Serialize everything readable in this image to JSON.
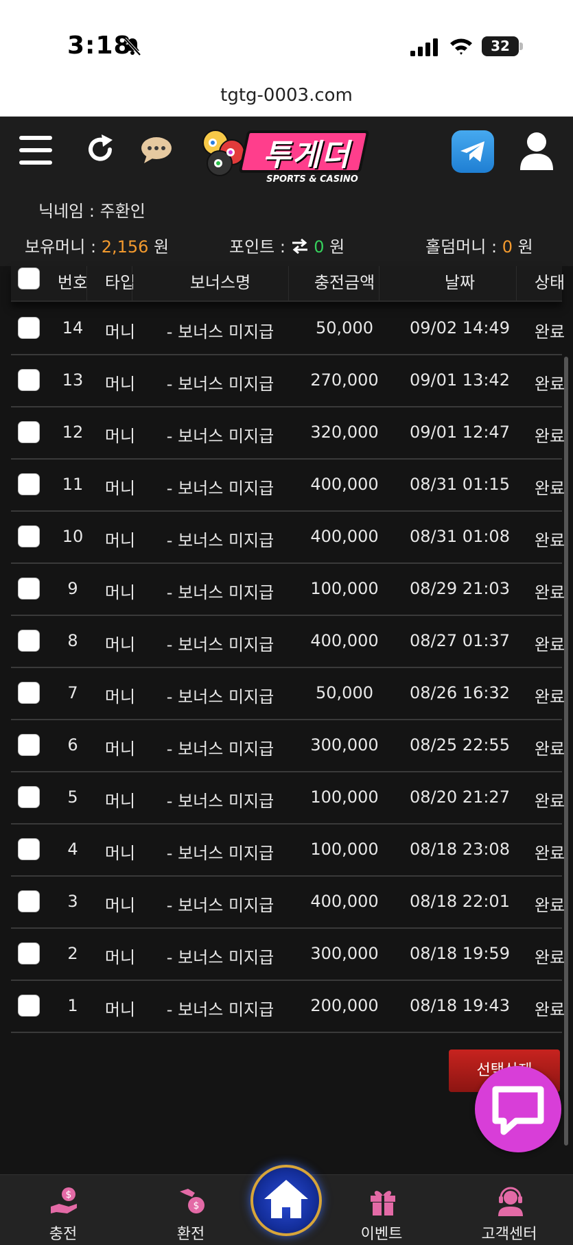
{
  "status_bar": {
    "time": "3:18",
    "battery": "32"
  },
  "browser": {
    "url": "tgtg-0003.com"
  },
  "header": {
    "logo_name": "투게더",
    "logo_sub": "SPORTS & CASINO",
    "nickname_label": "닉네임 : 주환인",
    "money_label": "보유머니 :",
    "money_value": "2,156",
    "money_unit": "원",
    "point_label": "포인트 :",
    "point_value": "0",
    "point_unit": "원",
    "holdem_label": "홀덤머니 :",
    "holdem_value": "0",
    "holdem_unit": "원"
  },
  "table": {
    "headers": [
      "번호",
      "타입",
      "보너스명",
      "충전금액",
      "날짜",
      "상태"
    ],
    "rows": [
      {
        "no": "14",
        "type": "머니",
        "bonus": "- 보너스 미지급",
        "amount": "50,000",
        "date": "09/02 14:49",
        "status": "완료"
      },
      {
        "no": "13",
        "type": "머니",
        "bonus": "- 보너스 미지급",
        "amount": "270,000",
        "date": "09/01 13:42",
        "status": "완료"
      },
      {
        "no": "12",
        "type": "머니",
        "bonus": "- 보너스 미지급",
        "amount": "320,000",
        "date": "09/01 12:47",
        "status": "완료"
      },
      {
        "no": "11",
        "type": "머니",
        "bonus": "- 보너스 미지급",
        "amount": "400,000",
        "date": "08/31 01:15",
        "status": "완료"
      },
      {
        "no": "10",
        "type": "머니",
        "bonus": "- 보너스 미지급",
        "amount": "400,000",
        "date": "08/31 01:08",
        "status": "완료"
      },
      {
        "no": "9",
        "type": "머니",
        "bonus": "- 보너스 미지급",
        "amount": "100,000",
        "date": "08/29 21:03",
        "status": "완료"
      },
      {
        "no": "8",
        "type": "머니",
        "bonus": "- 보너스 미지급",
        "amount": "400,000",
        "date": "08/27 01:37",
        "status": "완료"
      },
      {
        "no": "7",
        "type": "머니",
        "bonus": "- 보너스 미지급",
        "amount": "50,000",
        "date": "08/26 16:32",
        "status": "완료"
      },
      {
        "no": "6",
        "type": "머니",
        "bonus": "- 보너스 미지급",
        "amount": "300,000",
        "date": "08/25 22:55",
        "status": "완료"
      },
      {
        "no": "5",
        "type": "머니",
        "bonus": "- 보너스 미지급",
        "amount": "100,000",
        "date": "08/20 21:27",
        "status": "완료"
      },
      {
        "no": "4",
        "type": "머니",
        "bonus": "- 보너스 미지급",
        "amount": "100,000",
        "date": "08/18 23:08",
        "status": "완료"
      },
      {
        "no": "3",
        "type": "머니",
        "bonus": "- 보너스 미지급",
        "amount": "400,000",
        "date": "08/18 22:01",
        "status": "완료"
      },
      {
        "no": "2",
        "type": "머니",
        "bonus": "- 보너스 미지급",
        "amount": "300,000",
        "date": "08/18 19:59",
        "status": "완료"
      },
      {
        "no": "1",
        "type": "머니",
        "bonus": "- 보너스 미지급",
        "amount": "200,000",
        "date": "08/18 19:43",
        "status": "완료"
      }
    ]
  },
  "actions": {
    "delete_selected": "선택삭제"
  },
  "bottom_nav": {
    "items": [
      {
        "label": "충전",
        "icon": "deposit-icon"
      },
      {
        "label": "환전",
        "icon": "withdraw-icon"
      },
      {
        "label": "이벤트",
        "icon": "gift-icon"
      },
      {
        "label": "고객센터",
        "icon": "support-icon"
      }
    ]
  },
  "colors": {
    "accent_orange": "#f39a2e",
    "accent_green": "#36d05c",
    "danger_red": "#c7231f",
    "fab_pink": "#d83ed8"
  }
}
